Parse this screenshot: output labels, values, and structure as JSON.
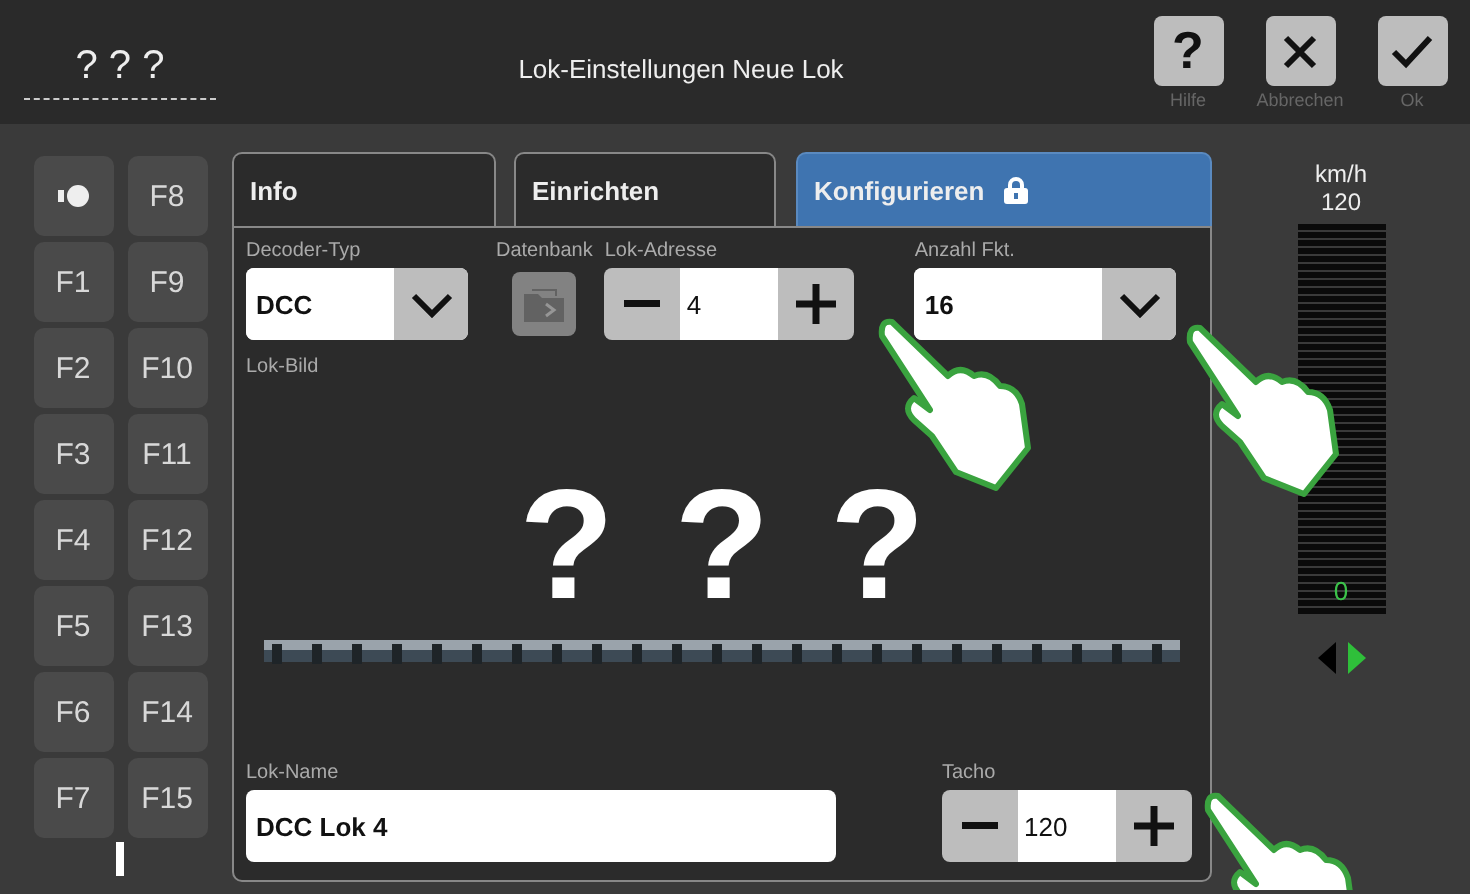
{
  "header": {
    "loco_name": "? ? ?",
    "title": "Lok-Einstellungen Neue Lok",
    "buttons": [
      {
        "kind": "help",
        "symbol": "?",
        "caption": "Hilfe"
      },
      {
        "kind": "cancel",
        "caption": "Abbrechen"
      },
      {
        "kind": "ok",
        "caption": "Ok"
      }
    ]
  },
  "functions": [
    {
      "kind": "light"
    },
    {
      "kind": "function",
      "label": "F8"
    },
    {
      "kind": "function",
      "label": "F1"
    },
    {
      "kind": "function",
      "label": "F9"
    },
    {
      "kind": "function",
      "label": "F2"
    },
    {
      "kind": "function",
      "label": "F10"
    },
    {
      "kind": "function",
      "label": "F3"
    },
    {
      "kind": "function",
      "label": "F11"
    },
    {
      "kind": "function",
      "label": "F4"
    },
    {
      "kind": "function",
      "label": "F12"
    },
    {
      "kind": "function",
      "label": "F5"
    },
    {
      "kind": "function",
      "label": "F13"
    },
    {
      "kind": "function",
      "label": "F6"
    },
    {
      "kind": "function",
      "label": "F14"
    },
    {
      "kind": "function",
      "label": "F7"
    },
    {
      "kind": "function",
      "label": "F15"
    }
  ],
  "tabs": [
    {
      "label": "Info",
      "selected": false,
      "locked": false
    },
    {
      "label": "Einrichten",
      "selected": false,
      "locked": false
    },
    {
      "label": "Konfigurieren",
      "selected": true,
      "locked": true
    }
  ],
  "settings": {
    "decoder_type": {
      "label": "Decoder-Typ",
      "value": "DCC"
    },
    "database": {
      "label": "Datenbank",
      "disabled": true
    },
    "address": {
      "label": "Lok-Adresse",
      "value": "4"
    },
    "function_count": {
      "label": "Anzahl Fkt.",
      "value": "16"
    },
    "loco_image": {
      "label": "Lok-Bild",
      "marks": [
        "?",
        "?",
        "?"
      ]
    },
    "loco_name": {
      "label": "Lok-Name",
      "value": "DCC Lok 4"
    },
    "tacho": {
      "label": "Tacho",
      "value": "120"
    }
  },
  "speedometer": {
    "unit": "km/h",
    "max": "120",
    "speed": "0",
    "level": 0,
    "directions": [
      {
        "kind": "reverse",
        "selected": false
      },
      {
        "kind": "forward",
        "selected": true
      }
    ]
  }
}
